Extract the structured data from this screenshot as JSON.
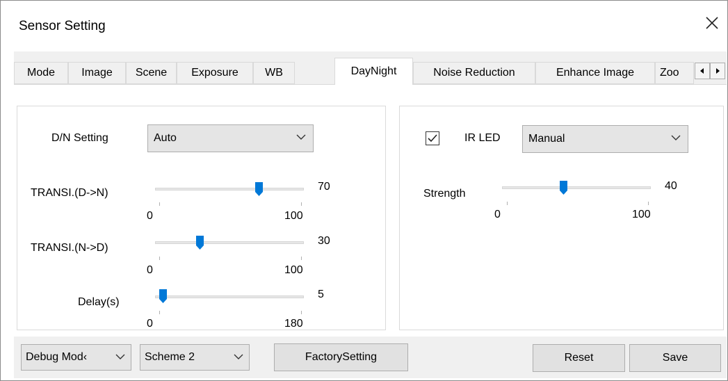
{
  "window": {
    "title": "Sensor Setting",
    "close_icon": "close-icon"
  },
  "tabs": [
    {
      "label": "Mode"
    },
    {
      "label": "Image"
    },
    {
      "label": "Scene"
    },
    {
      "label": "Exposure"
    },
    {
      "label": "WB"
    },
    {
      "label": "DayNight",
      "active": true
    },
    {
      "label": "Noise Reduction"
    },
    {
      "label": "Enhance Image"
    },
    {
      "label": "Zoo"
    }
  ],
  "daynight": {
    "dn_setting_label": "D/N Setting",
    "dn_setting_value": "Auto",
    "transi_dn": {
      "label": "TRANSI.(D->N)",
      "value": "70",
      "min": "0",
      "max": "100",
      "level": 70,
      "range": [
        0,
        100
      ]
    },
    "transi_nd": {
      "label": "TRANSI.(N->D)",
      "value": "30",
      "min": "0",
      "max": "100",
      "level": 30,
      "range": [
        0,
        100
      ]
    },
    "delay": {
      "label": "Delay(s)",
      "value": "5",
      "min": "0",
      "max": "180",
      "level": 5,
      "range": [
        0,
        180
      ]
    }
  },
  "ir": {
    "checked": true,
    "label": "IR LED",
    "mode_value": "Manual",
    "strength": {
      "label": "Strength",
      "value": "40",
      "min": "0",
      "max": "100",
      "level": 40,
      "range": [
        0,
        100
      ]
    }
  },
  "footer": {
    "debug_mode": "Debug Mod‹",
    "scheme": "Scheme 2",
    "factory_label": "FactorySetting",
    "reset_label": "Reset",
    "save_label": "Save"
  },
  "colors": {
    "accent": "#0078d7",
    "panel": "#f0f0f0",
    "border": "#adadad"
  }
}
